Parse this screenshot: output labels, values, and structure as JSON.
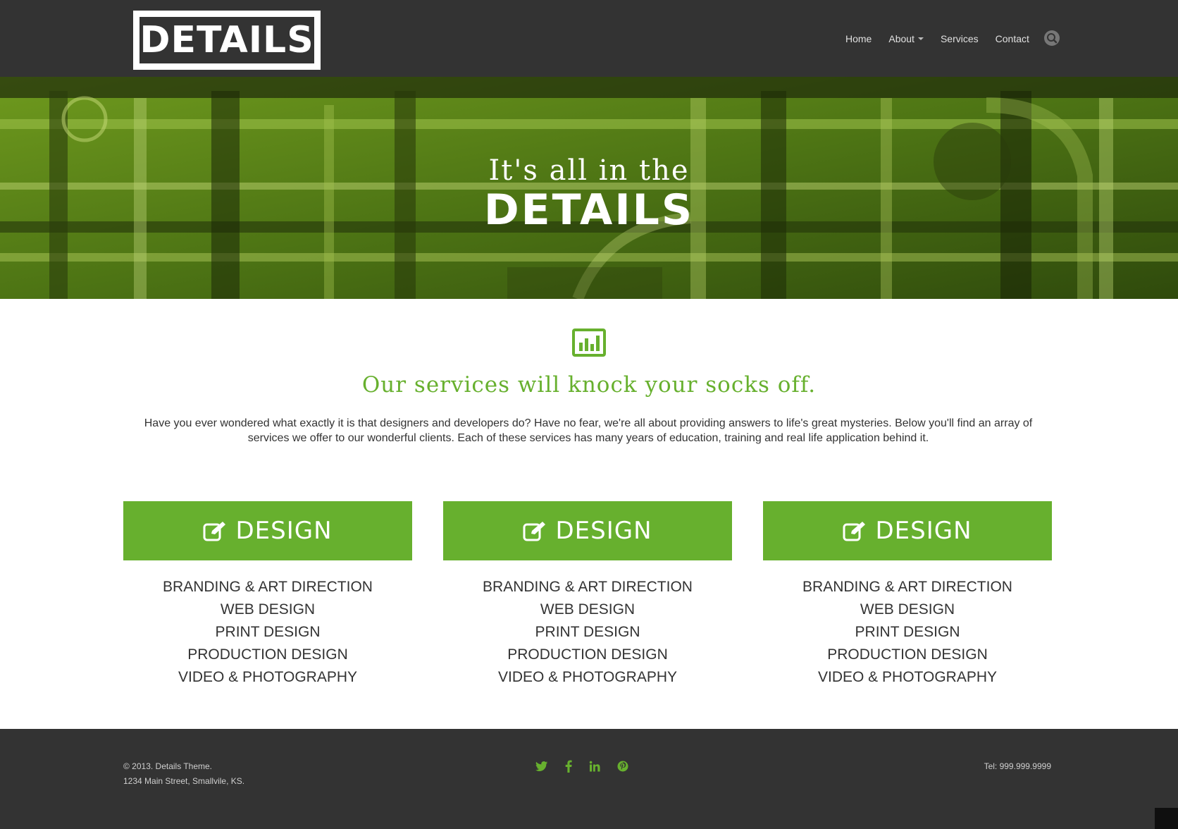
{
  "header": {
    "logo_text": "DETAILS",
    "nav": [
      {
        "label": "Home"
      },
      {
        "label": "About",
        "has_dropdown": true
      },
      {
        "label": "Services"
      },
      {
        "label": "Contact"
      }
    ],
    "search_icon": "search-icon"
  },
  "hero": {
    "line1": "It's all in the",
    "line2": "DETAILS"
  },
  "intro": {
    "icon": "bar-chart-icon",
    "heading": "Our services will knock your socks off.",
    "text": "Have you ever wondered what exactly it is that designers and developers do? Have no fear, we're all about providing answers to life's great mysteries. Below you'll find an array of services we offer to our wonderful clients. Each of these services has many years of education, training and real life application behind it."
  },
  "services": [
    {
      "title": "DESIGN",
      "icon": "edit-icon",
      "items": [
        "BRANDING & ART DIRECTION",
        "WEB DESIGN",
        "PRINT DESIGN",
        "PRODUCTION DESIGN",
        "VIDEO & PHOTOGRAPHY"
      ]
    },
    {
      "title": "DESIGN",
      "icon": "edit-icon",
      "items": [
        "BRANDING & ART DIRECTION",
        "WEB DESIGN",
        "PRINT DESIGN",
        "PRODUCTION DESIGN",
        "VIDEO & PHOTOGRAPHY"
      ]
    },
    {
      "title": "DESIGN",
      "icon": "edit-icon",
      "items": [
        "BRANDING & ART DIRECTION",
        "WEB DESIGN",
        "PRINT DESIGN",
        "PRODUCTION DESIGN",
        "VIDEO & PHOTOGRAPHY"
      ]
    }
  ],
  "footer": {
    "copyright": "© 2013. Details Theme.",
    "address": "1234 Main Street, Smallvile, KS.",
    "phone": "Tel: 999.999.9999",
    "socials": [
      "twitter-icon",
      "facebook-icon",
      "linkedin-icon",
      "pinterest-icon"
    ]
  },
  "colors": {
    "accent": "#67b02e",
    "header_bg": "#333333",
    "footer_bg": "#333333"
  }
}
